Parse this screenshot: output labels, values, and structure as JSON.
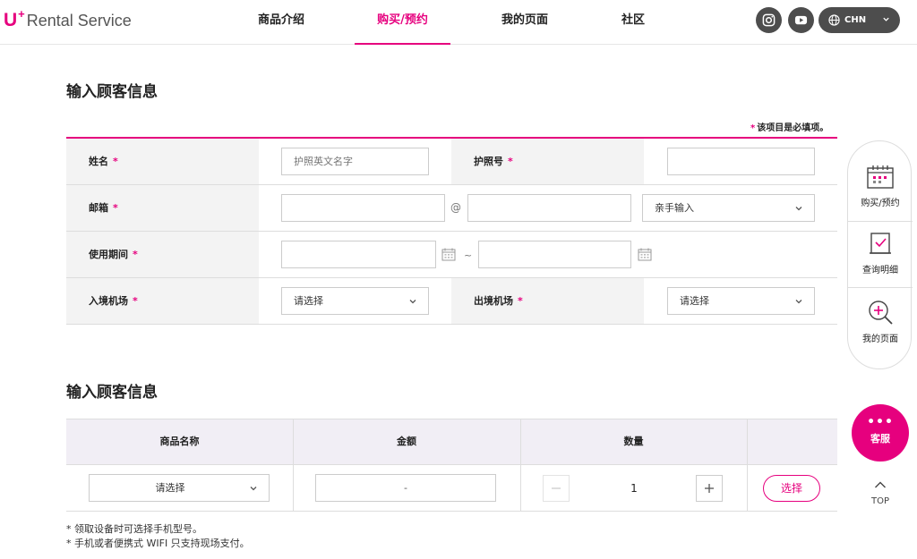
{
  "header": {
    "logo": {
      "mark": "U",
      "plus": "+",
      "text": "Rental Service"
    },
    "nav": [
      "商品介绍",
      "购买/预约",
      "我的页面",
      "社区"
    ],
    "active_nav": "购买/预约",
    "social": [
      {
        "icon": "instagram-icon"
      },
      {
        "icon": "youtube-icon"
      }
    ],
    "language": {
      "icon": "globe-icon",
      "label": "CHN"
    }
  },
  "customer_section": {
    "title": "输入顾客信息",
    "required_note": "该项目是必填项。",
    "required_mark": "*",
    "name": {
      "label": "姓名",
      "placeholder": "护照英文名字",
      "value": ""
    },
    "passport": {
      "label": "护照号",
      "value": ""
    },
    "email": {
      "label": "邮箱",
      "local": "",
      "at": "@",
      "domain": "",
      "domain_select": "亲手输入"
    },
    "period": {
      "label": "使用期间",
      "start": "",
      "separator": "~",
      "end": ""
    },
    "arrival": {
      "label": "入境机场",
      "select": "请选择"
    },
    "departure": {
      "label": "出境机场",
      "select": "请选择"
    }
  },
  "product_section": {
    "title": "输入顾客信息",
    "columns": [
      "商品名称",
      "金额",
      "数量",
      ""
    ],
    "row": {
      "product_select": "请选择",
      "amount": "-",
      "quantity": "1",
      "choose_label": "选择"
    },
    "notes": [
      "* 领取设备时可选择手机型号。",
      "* 手机或者便携式 WIFI 只支持现场支付。"
    ]
  },
  "quick_menu": [
    {
      "label": "购买/预约",
      "icon": "calendar-icon"
    },
    {
      "label": "查询明细",
      "icon": "document-check-icon"
    },
    {
      "label": "我的页面",
      "icon": "magnifier-plus-icon"
    }
  ],
  "chat_button": {
    "dots": "•••",
    "label": "客服"
  },
  "top_button": {
    "label": "TOP"
  },
  "colors": {
    "accent": "#e6007e",
    "dark": "#4d4d4d",
    "table_head": "#f1eef5"
  }
}
